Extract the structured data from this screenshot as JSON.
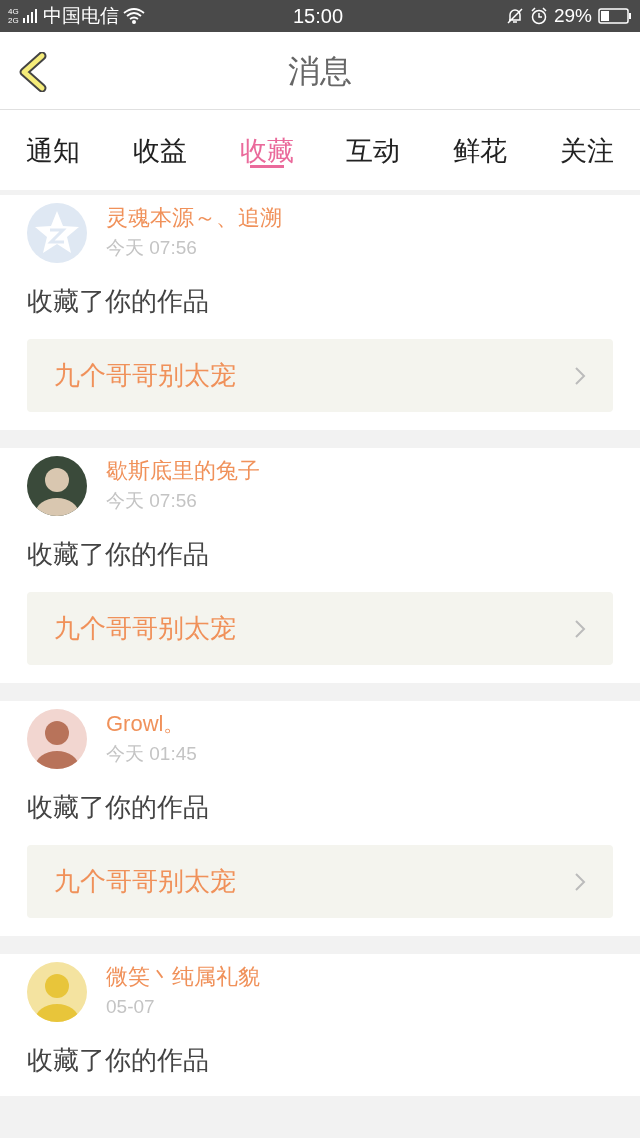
{
  "status_bar": {
    "network": "4G",
    "network_2": "2G",
    "carrier": "中国电信",
    "time": "15:00",
    "battery": "29%"
  },
  "header": {
    "title": "消息"
  },
  "tabs": [
    {
      "label": "通知",
      "selected": false
    },
    {
      "label": "收益",
      "selected": false
    },
    {
      "label": "收藏",
      "selected": true
    },
    {
      "label": "互动",
      "selected": false
    },
    {
      "label": "鲜花",
      "selected": false
    },
    {
      "label": "关注",
      "selected": false
    }
  ],
  "messages": [
    {
      "avatar": {
        "kind": "default"
      },
      "name": "灵魂本源～、追溯",
      "time": "今天 07:56",
      "action": "收藏了你的作品",
      "work": "九个哥哥别太宠"
    },
    {
      "name": "歇斯底里的兔子",
      "time": "今天 07:56",
      "action": "收藏了你的作品",
      "work": "九个哥哥别太宠"
    },
    {
      "name": "Growl。",
      "time": "今天 01:45",
      "action": "收藏了你的作品",
      "work": "九个哥哥别太宠"
    },
    {
      "name": "微笑丶纯属礼貌",
      "time": "05-07",
      "action": "收藏了你的作品"
    }
  ]
}
